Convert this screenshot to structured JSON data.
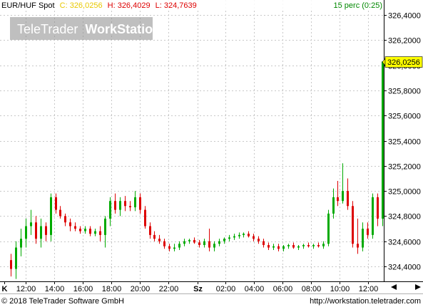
{
  "header": {
    "symbol": "EUR/HUF Spot",
    "close_text": "C: 326,0256",
    "high_text": "H: 326,4029",
    "low_text": "L: 324,7639",
    "interval_text": "15 perc (0:25)"
  },
  "watermark": {
    "brand": "TeleTrader",
    "product": "WorkStation"
  },
  "footer": {
    "copyright": "© 2018 TeleTrader Software GmbH",
    "url": "http://workstation.teletrader.com"
  },
  "last_price_label": "326,0256",
  "colors": {
    "up": "#00aa00",
    "down": "#dd0000",
    "grid": "#c8c8c8",
    "last_price_bg": "#ffff00",
    "header_close": "#e8c800",
    "header_high": "#dd0000",
    "header_interval": "#008800"
  },
  "chart_data": {
    "type": "candlestick",
    "title": "EUR/HUF Spot",
    "interval": "15 perc",
    "x_ticks": [
      "K",
      "12:00",
      "14:00",
      "16:00",
      "18:00",
      "20:00",
      "22:00",
      "Sz",
      "02:00",
      "04:00",
      "06:00",
      "08:00",
      "10:00",
      "12:00"
    ],
    "y_ticks": [
      "326,4000",
      "326,2000",
      "326,0000",
      "325,8000",
      "325,6000",
      "325,4000",
      "325,2000",
      "325,0000",
      "324,8000",
      "324,6000",
      "324,4000"
    ],
    "y_tick_values": [
      326.4,
      326.2,
      326.0,
      325.8,
      325.6,
      325.4,
      325.2,
      325.0,
      324.8,
      324.6,
      324.4
    ],
    "ylim": [
      324.3,
      326.5
    ],
    "grid": true,
    "last_price": 326.0256,
    "summary": {
      "close": 326.0256,
      "high": 326.4029,
      "low": 324.7639
    },
    "candles": [
      [
        324.45,
        324.5,
        324.32,
        324.38
      ],
      [
        324.38,
        324.6,
        324.3,
        324.55
      ],
      [
        324.55,
        324.7,
        324.48,
        324.62
      ],
      [
        324.62,
        324.78,
        324.55,
        324.72
      ],
      [
        324.72,
        324.85,
        324.65,
        324.75
      ],
      [
        324.75,
        324.8,
        324.58,
        324.62
      ],
      [
        324.62,
        324.78,
        324.55,
        324.72
      ],
      [
        324.72,
        324.75,
        324.6,
        324.65
      ],
      [
        324.65,
        324.98,
        324.6,
        324.95
      ],
      [
        324.95,
        324.98,
        324.82,
        324.85
      ],
      [
        324.85,
        324.88,
        324.78,
        324.8
      ],
      [
        324.8,
        324.82,
        324.72,
        324.75
      ],
      [
        324.75,
        324.78,
        324.68,
        324.72
      ],
      [
        324.72,
        324.75,
        324.68,
        324.7
      ],
      [
        324.7,
        324.72,
        324.66,
        324.68
      ],
      [
        324.68,
        324.72,
        324.66,
        324.7
      ],
      [
        324.7,
        324.72,
        324.64,
        324.66
      ],
      [
        324.66,
        324.7,
        324.64,
        324.68
      ],
      [
        324.68,
        324.72,
        324.6,
        324.65
      ],
      [
        324.65,
        324.8,
        324.55,
        324.78
      ],
      [
        324.78,
        324.95,
        324.72,
        324.92
      ],
      [
        324.92,
        324.98,
        324.82,
        324.85
      ],
      [
        324.85,
        324.95,
        324.8,
        324.92
      ],
      [
        324.92,
        324.96,
        324.84,
        324.88
      ],
      [
        324.88,
        324.92,
        324.84,
        324.87
      ],
      [
        324.87,
        325.0,
        324.84,
        324.95
      ],
      [
        324.95,
        324.98,
        324.82,
        324.85
      ],
      [
        324.85,
        324.88,
        324.7,
        324.72
      ],
      [
        324.72,
        324.75,
        324.62,
        324.65
      ],
      [
        324.65,
        324.68,
        324.6,
        324.62
      ],
      [
        324.62,
        324.65,
        324.58,
        324.6
      ],
      [
        324.6,
        324.62,
        324.54,
        324.56
      ],
      [
        324.56,
        324.58,
        324.52,
        324.54
      ],
      [
        324.54,
        324.58,
        324.52,
        324.55
      ],
      [
        324.55,
        324.6,
        324.53,
        324.58
      ],
      [
        324.58,
        324.62,
        324.56,
        324.6
      ],
      [
        324.6,
        324.62,
        324.58,
        324.61
      ],
      [
        324.61,
        324.63,
        324.58,
        324.59
      ],
      [
        324.59,
        324.61,
        324.55,
        324.57
      ],
      [
        324.57,
        324.62,
        324.55,
        324.6
      ],
      [
        324.6,
        324.7,
        324.52,
        324.55
      ],
      [
        324.55,
        324.6,
        324.52,
        324.58
      ],
      [
        324.58,
        324.62,
        324.56,
        324.6
      ],
      [
        324.6,
        324.63,
        324.58,
        324.62
      ],
      [
        324.62,
        324.65,
        324.6,
        324.63
      ],
      [
        324.63,
        324.66,
        324.61,
        324.64
      ],
      [
        324.64,
        324.67,
        324.62,
        324.65
      ],
      [
        324.65,
        324.67,
        324.63,
        324.66
      ],
      [
        324.66,
        324.68,
        324.63,
        324.64
      ],
      [
        324.64,
        324.66,
        324.6,
        324.62
      ],
      [
        324.62,
        324.64,
        324.58,
        324.6
      ],
      [
        324.6,
        324.62,
        324.55,
        324.57
      ],
      [
        324.57,
        324.59,
        324.53,
        324.55
      ],
      [
        324.55,
        324.58,
        324.53,
        324.56
      ],
      [
        324.56,
        324.58,
        324.52,
        324.54
      ],
      [
        324.54,
        324.57,
        324.52,
        324.56
      ],
      [
        324.56,
        324.58,
        324.54,
        324.57
      ],
      [
        324.57,
        324.59,
        324.54,
        324.55
      ],
      [
        324.55,
        324.57,
        324.53,
        324.56
      ],
      [
        324.56,
        324.58,
        324.54,
        324.57
      ],
      [
        324.57,
        324.59,
        324.55,
        324.56
      ],
      [
        324.56,
        324.58,
        324.54,
        324.57
      ],
      [
        324.57,
        324.59,
        324.55,
        324.56
      ],
      [
        324.56,
        324.6,
        324.54,
        324.58
      ],
      [
        324.58,
        324.85,
        324.56,
        324.82
      ],
      [
        324.82,
        325.02,
        324.78,
        324.95
      ],
      [
        324.95,
        325.08,
        324.88,
        324.92
      ],
      [
        324.92,
        325.22,
        324.9,
        325.0
      ],
      [
        325.0,
        325.1,
        324.85,
        324.88
      ],
      [
        324.88,
        324.92,
        324.55,
        324.58
      ],
      [
        324.58,
        324.78,
        324.5,
        324.55
      ],
      [
        324.55,
        324.75,
        324.52,
        324.7
      ],
      [
        324.7,
        324.75,
        324.62,
        324.65
      ],
      [
        324.65,
        324.98,
        324.62,
        324.95
      ],
      [
        324.95,
        324.98,
        324.72,
        324.78
      ],
      [
        324.78,
        325.05,
        324.72,
        326.03
      ]
    ]
  }
}
